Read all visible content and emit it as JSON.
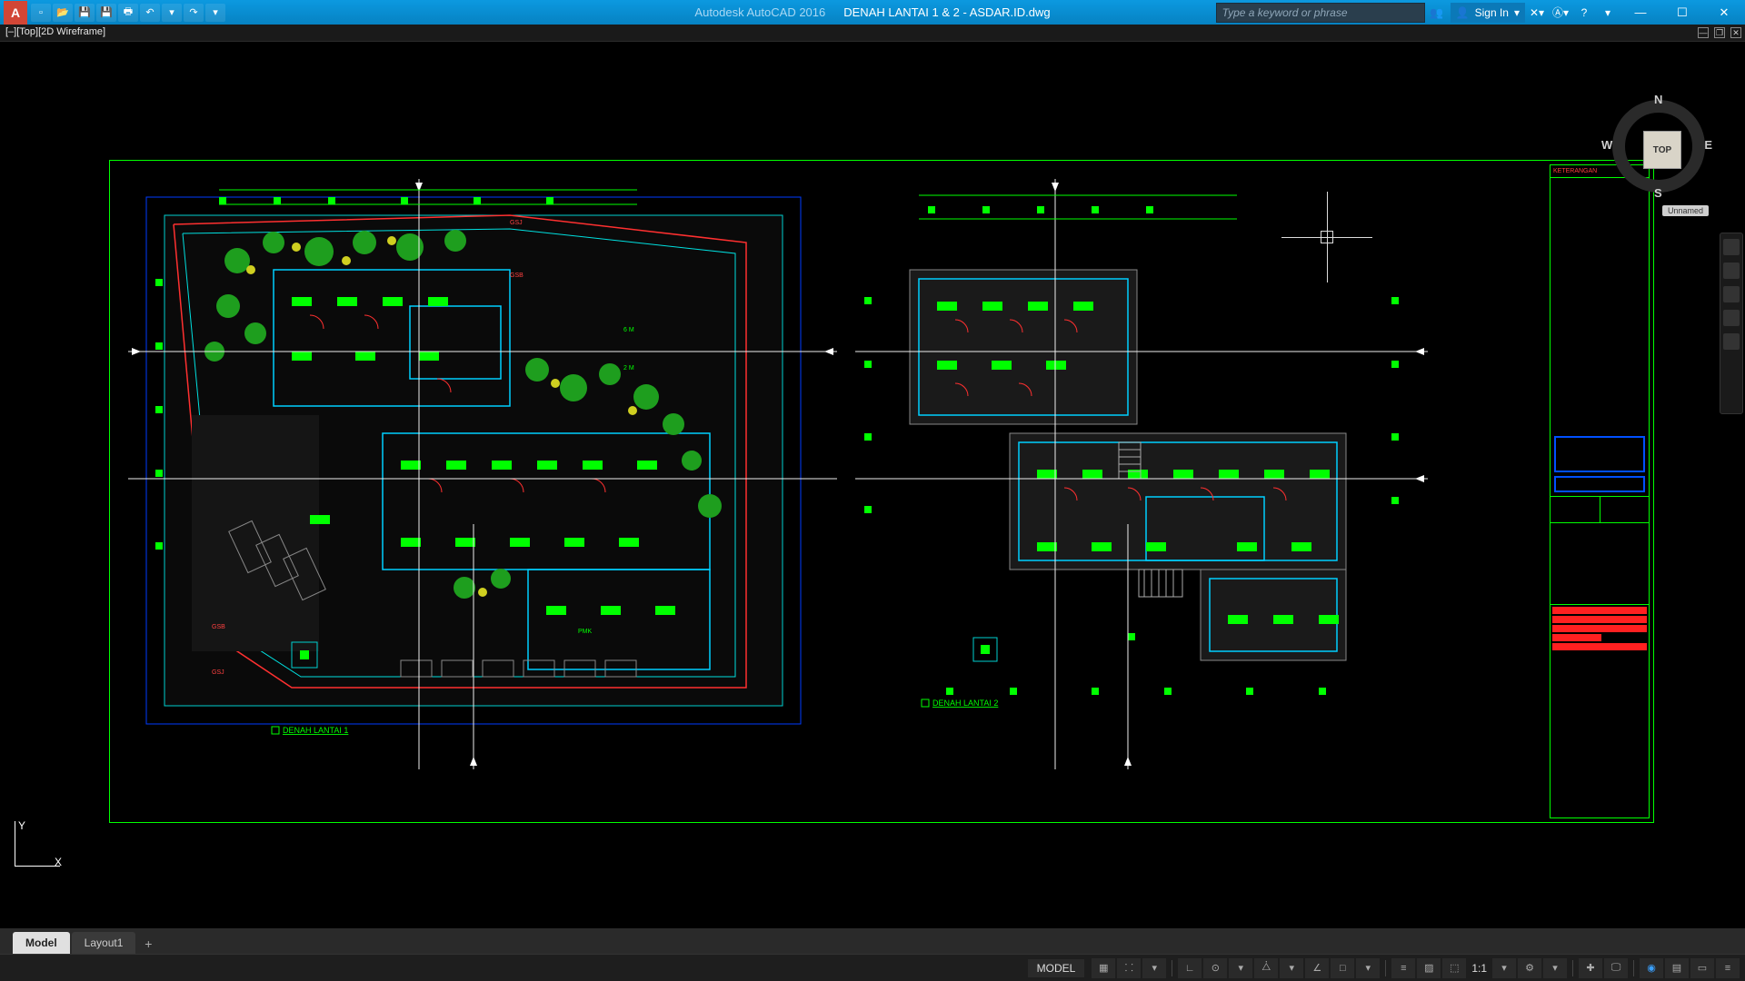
{
  "titlebar": {
    "app_name": "Autodesk AutoCAD 2016",
    "file_name": "DENAH LANTAI 1 & 2 - ASDAR.ID.dwg",
    "search_placeholder": "Type a keyword or phrase",
    "sign_in": "Sign In"
  },
  "qat": {
    "items": [
      "new",
      "open",
      "save",
      "saveas",
      "plot",
      "undo",
      "redo"
    ]
  },
  "viewport": {
    "label": "[–][Top][2D Wireframe]"
  },
  "viewcube": {
    "face": "TOP",
    "n": "N",
    "s": "S",
    "e": "E",
    "w": "W",
    "ucs_name": "Unnamed"
  },
  "ucs": {
    "x": "X",
    "y": "Y"
  },
  "plan_labels": {
    "floor1": "DENAH LANTAI 1",
    "floor2": "DENAH LANTAI 2",
    "keterangan": "KETERANGAN"
  },
  "tabs": {
    "model": "Model",
    "layout1": "Layout1"
  },
  "status": {
    "space": "MODEL",
    "scale": "1:1"
  }
}
